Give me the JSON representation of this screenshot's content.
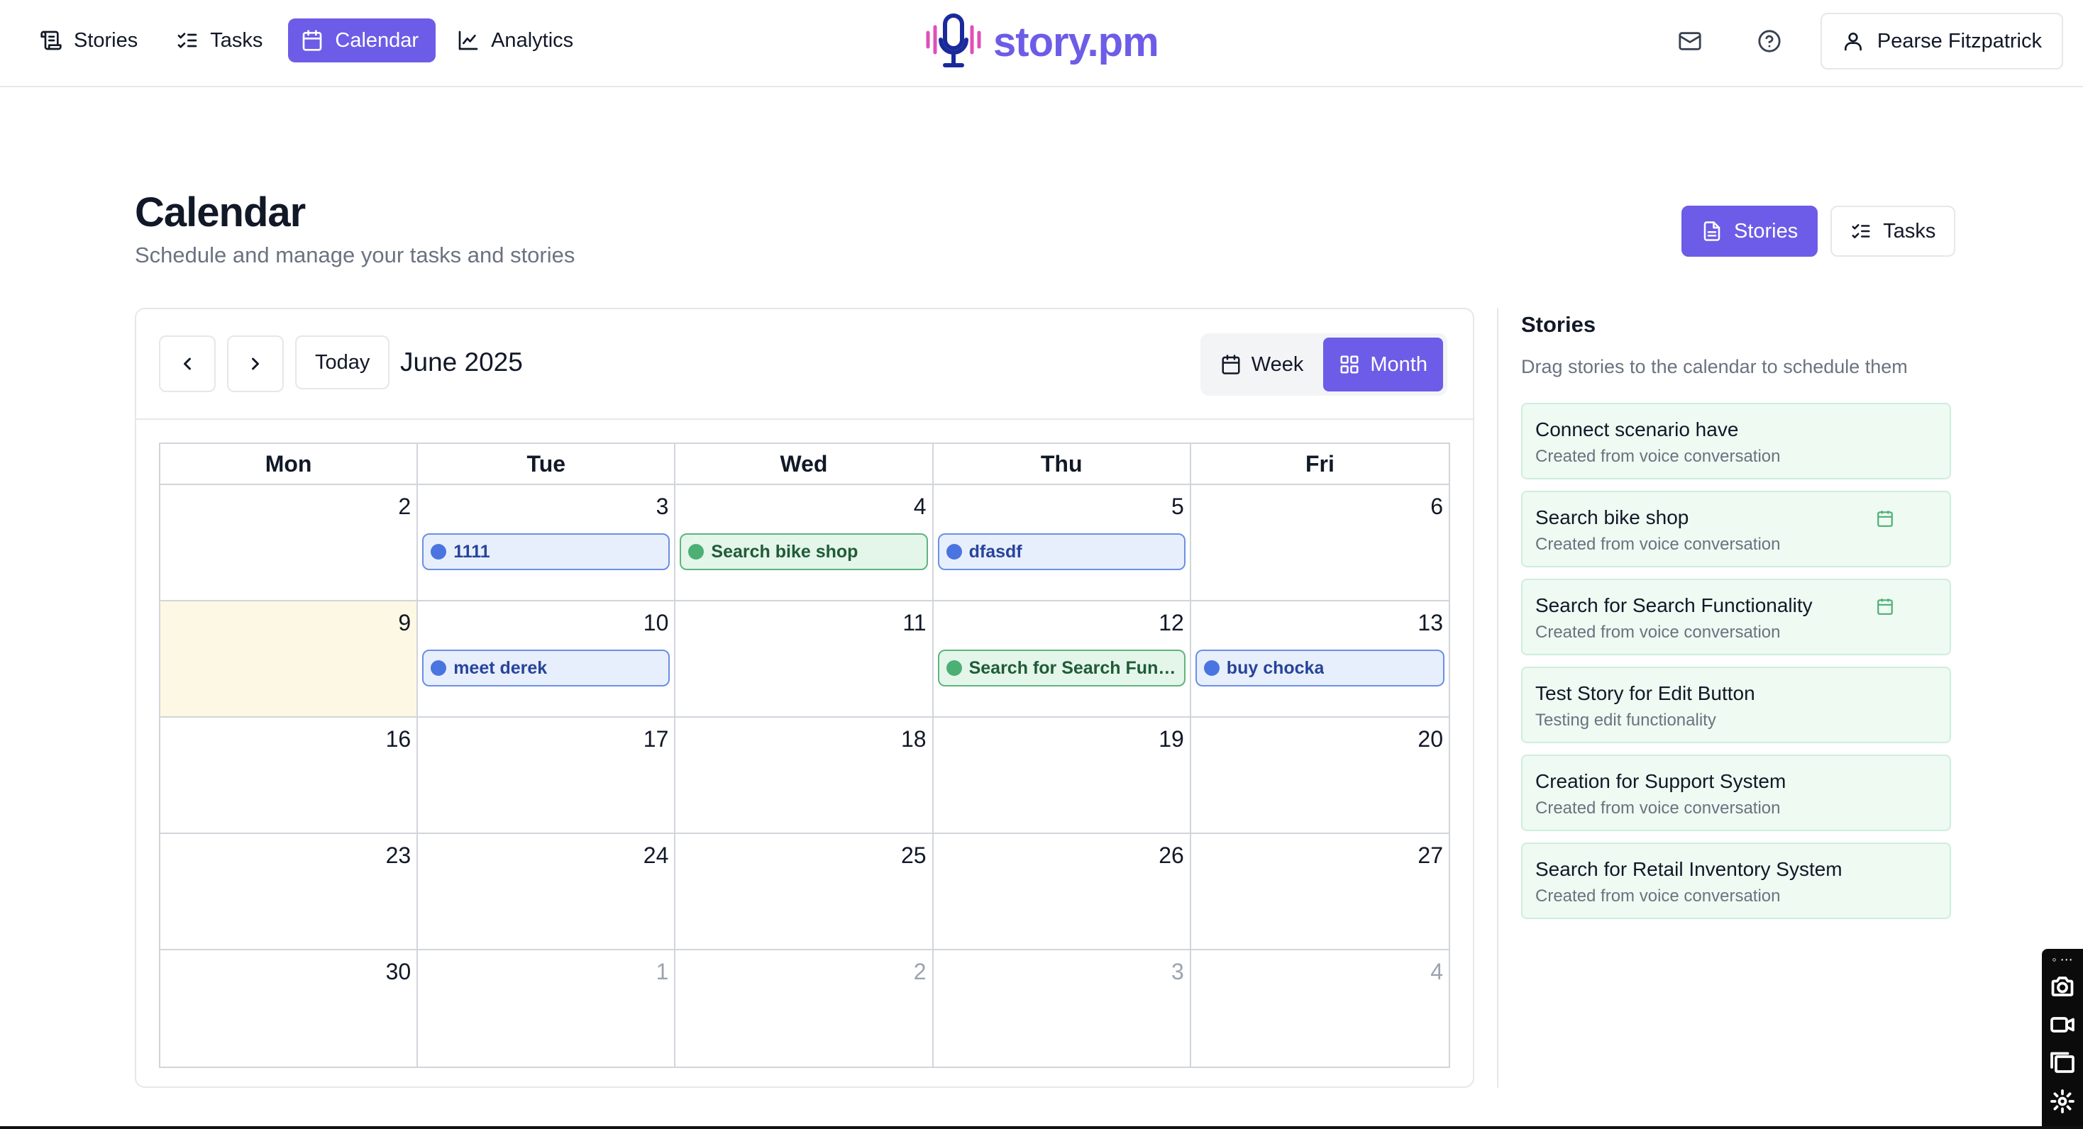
{
  "nav": {
    "items": [
      {
        "label": "Stories",
        "icon": "scroll-icon",
        "active": false
      },
      {
        "label": "Tasks",
        "icon": "list-checks-icon",
        "active": false
      },
      {
        "label": "Calendar",
        "icon": "calendar-icon",
        "active": true
      },
      {
        "label": "Analytics",
        "icon": "line-chart-icon",
        "active": false
      }
    ]
  },
  "brand": {
    "name": "story.pm",
    "color": "#6d5ce7"
  },
  "user": {
    "name": "Pearse Fitzpatrick"
  },
  "header": {
    "title": "Calendar",
    "subtitle": "Schedule and manage your tasks and stories",
    "toggle": {
      "stories": "Stories",
      "tasks": "Tasks",
      "active": "stories"
    }
  },
  "calendar": {
    "today_label": "Today",
    "month_label": "June 2025",
    "range": {
      "week": "Week",
      "month": "Month",
      "active": "month"
    },
    "weekdays": [
      "Mon",
      "Tue",
      "Wed",
      "Thu",
      "Fri"
    ],
    "weeks": [
      [
        {
          "day": "2"
        },
        {
          "day": "3",
          "event": {
            "label": "1111",
            "color": "blue"
          }
        },
        {
          "day": "4",
          "event": {
            "label": "Search bike shop",
            "color": "green"
          }
        },
        {
          "day": "5",
          "event": {
            "label": "dfasdf",
            "color": "blue"
          }
        },
        {
          "day": "6"
        }
      ],
      [
        {
          "day": "9",
          "today": true
        },
        {
          "day": "10",
          "event": {
            "label": "meet derek",
            "color": "blue"
          }
        },
        {
          "day": "11"
        },
        {
          "day": "12",
          "event": {
            "label": "Search for Search Func...",
            "color": "green"
          }
        },
        {
          "day": "13",
          "event": {
            "label": "buy chocka",
            "color": "blue"
          }
        }
      ],
      [
        {
          "day": "16"
        },
        {
          "day": "17"
        },
        {
          "day": "18"
        },
        {
          "day": "19"
        },
        {
          "day": "20"
        }
      ],
      [
        {
          "day": "23"
        },
        {
          "day": "24"
        },
        {
          "day": "25"
        },
        {
          "day": "26"
        },
        {
          "day": "27"
        }
      ],
      [
        {
          "day": "30"
        },
        {
          "day": "1",
          "other_month": true
        },
        {
          "day": "2",
          "other_month": true
        },
        {
          "day": "3",
          "other_month": true
        },
        {
          "day": "4",
          "other_month": true
        }
      ]
    ]
  },
  "stories_panel": {
    "title": "Stories",
    "subtitle": "Drag stories to the calendar to schedule them",
    "items": [
      {
        "title": "Connect scenario have",
        "desc": "Created from voice conversation",
        "scheduled": false
      },
      {
        "title": "Search bike shop",
        "desc": "Created from voice conversation",
        "scheduled": true
      },
      {
        "title": "Search for Search Functionality",
        "desc": "Created from voice conversation",
        "scheduled": true
      },
      {
        "title": "Test Story for Edit Button",
        "desc": "Testing edit functionality",
        "scheduled": false
      },
      {
        "title": "Creation for Support System",
        "desc": "Created from voice conversation",
        "scheduled": false
      },
      {
        "title": "Search for Retail Inventory System",
        "desc": "Created from voice conversation",
        "scheduled": false
      }
    ]
  },
  "recorder": {
    "grip": "◦ ⋯"
  }
}
